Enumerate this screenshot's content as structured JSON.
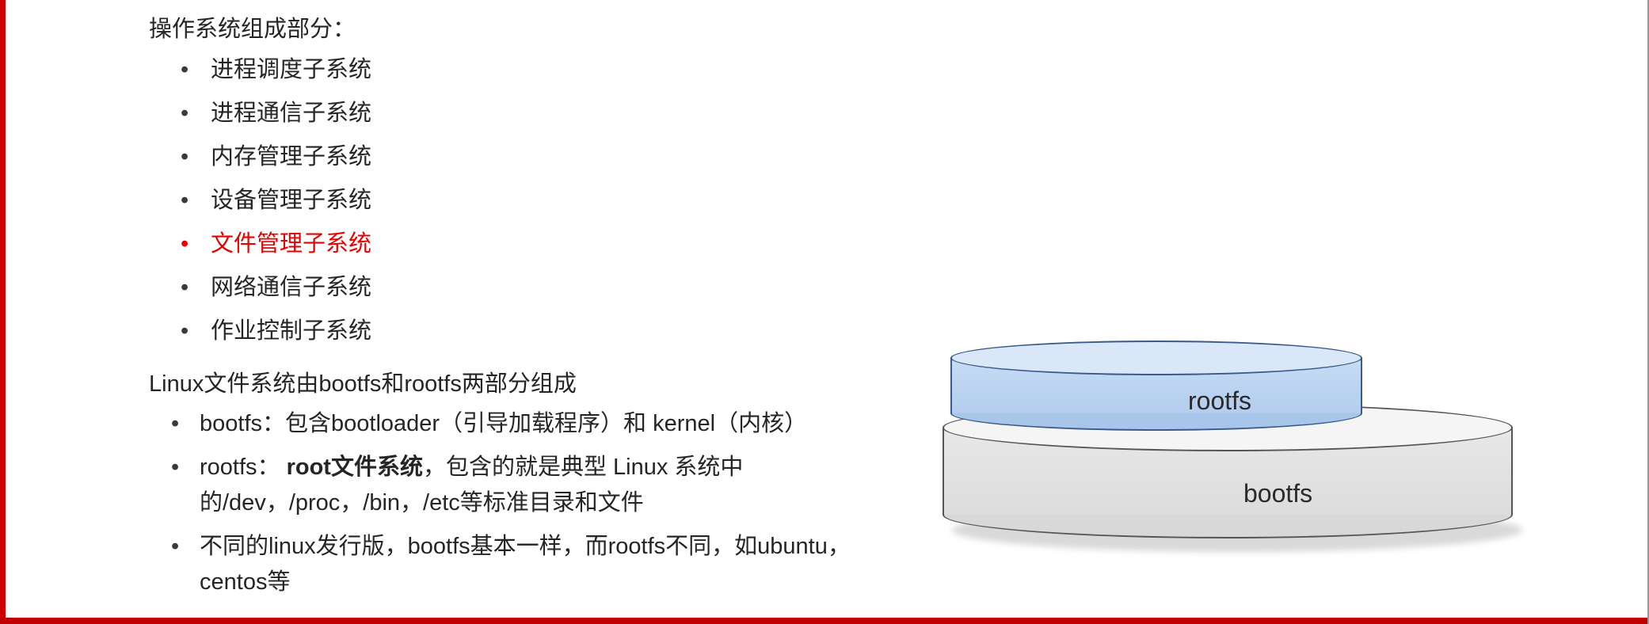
{
  "heading": "操作系统组成部分：",
  "subsystems": [
    "进程调度子系统",
    "进程通信子系统",
    "内存管理子系统",
    "设备管理子系统",
    "文件管理子系统",
    "网络通信子系统",
    "作业控制子系统"
  ],
  "highlight_index": 4,
  "fs_intro": "Linux文件系统由bootfs和rootfs两部分组成",
  "fs_points": [
    {
      "plain": "bootfs：包含bootloader（引导加载程序）和 kernel（内核）"
    },
    {
      "prefix": "rootfs： ",
      "bold": "root文件系统",
      "rest": "，包含的就是典型 Linux 系统中的/dev，/proc，/bin，/etc等标准目录和文件"
    },
    {
      "plain": "不同的linux发行版，bootfs基本一样，而rootfs不同，如ubuntu，centos等"
    }
  ],
  "diagram": {
    "top_label": "rootfs",
    "bottom_label": "bootfs"
  }
}
